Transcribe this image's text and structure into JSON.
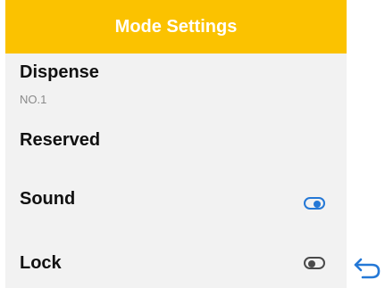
{
  "header": {
    "title": "Mode Settings",
    "color": "#fbc200"
  },
  "items": {
    "dispense": {
      "label": "Dispense",
      "value": "NO.1"
    },
    "reserved": {
      "label": "Reserved"
    },
    "sound": {
      "label": "Sound",
      "toggle": "on"
    },
    "lock": {
      "label": "Lock",
      "toggle": "off"
    }
  },
  "icons": {
    "back": "return-arrow-icon"
  },
  "colors": {
    "panel_bg": "#f2f2f2",
    "toggle_on": "#2478d6",
    "toggle_off": "#4a4a4a"
  }
}
